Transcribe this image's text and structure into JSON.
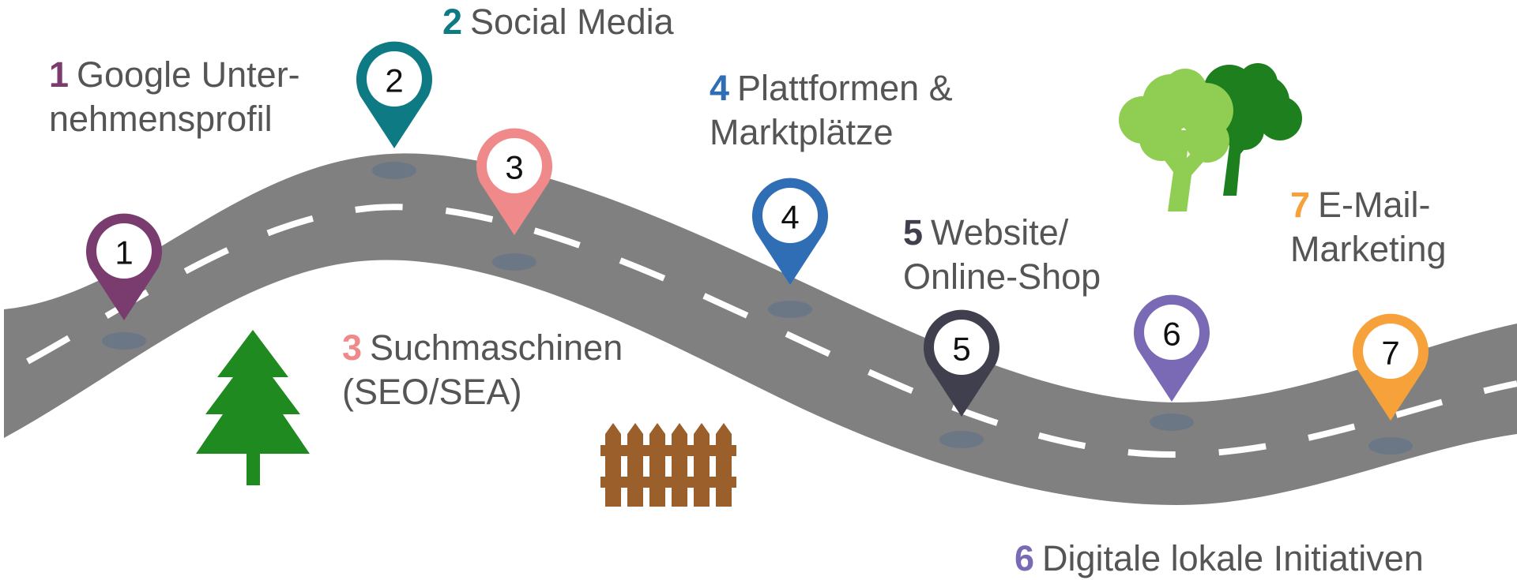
{
  "steps": [
    {
      "num": "1",
      "lines": [
        "Google Unter-",
        "nehmensprofil"
      ],
      "color": "#7a3b6e"
    },
    {
      "num": "2",
      "lines": [
        "Social Media"
      ],
      "color": "#0e7a84"
    },
    {
      "num": "3",
      "lines": [
        "Suchmaschinen",
        "(SEO/SEA)"
      ],
      "color": "#f08a8a"
    },
    {
      "num": "4",
      "lines": [
        "Plattformen &",
        "Marktplätze"
      ],
      "color": "#2f6db5"
    },
    {
      "num": "5",
      "lines": [
        "Website/",
        "Online-Shop"
      ],
      "color": "#3f3f4d"
    },
    {
      "num": "6",
      "lines": [
        "Digitale lokale Initiativen"
      ],
      "color": "#7a69b5"
    },
    {
      "num": "7",
      "lines": [
        "E-Mail-",
        "Marketing"
      ],
      "color": "#f6a13a"
    }
  ],
  "colors": {
    "road": "#808080",
    "road_marking": "#ffffff",
    "pin_shadow": "#6b7785",
    "pine_tree": "#1f8a1f",
    "tree_light": "#8fce52",
    "tree_dark": "#1e7f1e",
    "fence": "#9a5f2a"
  },
  "icons": [
    "pine-tree-icon",
    "deciduous-trees-icon",
    "wooden-fence-icon",
    "map-pin-icon"
  ]
}
